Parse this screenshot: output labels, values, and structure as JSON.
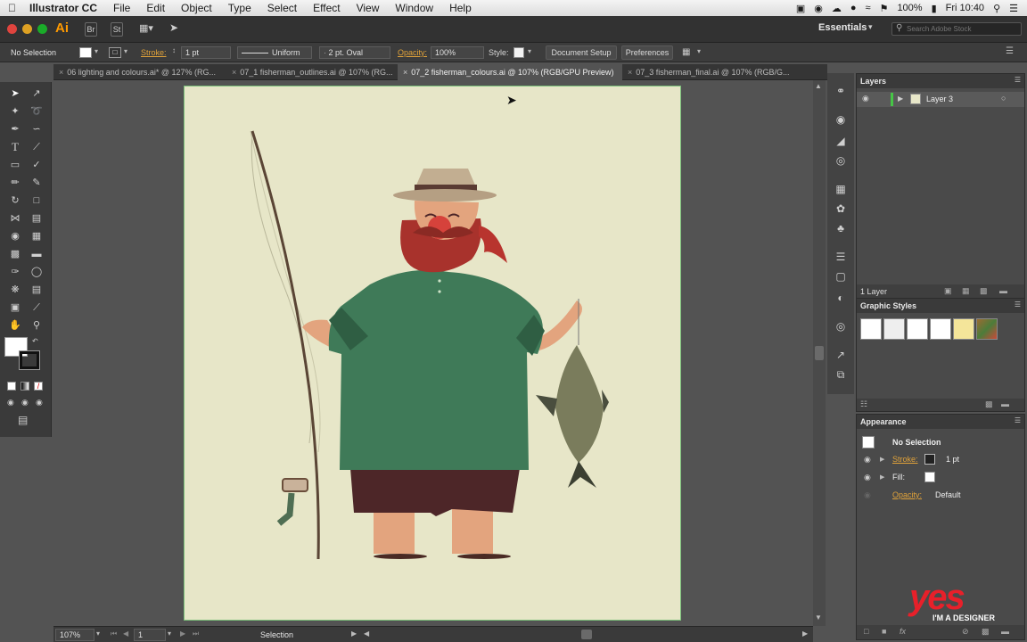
{
  "menubar": {
    "app_name": "Illustrator CC",
    "items": [
      "File",
      "Edit",
      "Object",
      "Type",
      "Select",
      "Effect",
      "View",
      "Window",
      "Help"
    ],
    "battery": "100%",
    "clock": "Fri 10:40"
  },
  "appbar": {
    "ai_logo": "Ai",
    "br_label": "Br",
    "st_label": "St",
    "workspace": "Essentials",
    "search_placeholder": "Search Adobe Stock"
  },
  "control": {
    "selection": "No Selection",
    "stroke_label": "Stroke:",
    "stroke_weight": "1 pt",
    "stroke_profile": "Uniform",
    "brush": "2 pt. Oval",
    "opacity_label": "Opacity:",
    "opacity": "100%",
    "style_label": "Style:",
    "document_setup": "Document Setup",
    "preferences": "Preferences"
  },
  "tabs": [
    {
      "label": "06 lighting and colours.ai* @ 127% (RG...",
      "active": false
    },
    {
      "label": "07_1 fisherman_outlines.ai @ 107% (RG...",
      "active": false
    },
    {
      "label": "07_2 fisherman_colours.ai @ 107% (RGB/GPU Preview)",
      "active": true
    },
    {
      "label": "07_3 fisherman_final.ai @ 107% (RGB/G...",
      "active": false
    }
  ],
  "layers": {
    "title": "Layers",
    "items": [
      {
        "name": "Layer 3"
      }
    ],
    "count": "1 Layer"
  },
  "graphic_styles": {
    "title": "Graphic Styles"
  },
  "appearance": {
    "title": "Appearance",
    "header": "No Selection",
    "rows": [
      {
        "label": "Stroke:",
        "value": "1 pt"
      },
      {
        "label": "Fill:",
        "value": ""
      },
      {
        "label": "Opacity:",
        "value": "Default"
      }
    ]
  },
  "status": {
    "zoom": "107%",
    "artboard": "1",
    "tool": "Selection"
  },
  "logo": {
    "big": "yes",
    "small": "I'M A DESIGNER"
  },
  "colors": {
    "artboard": "#e7e6c8",
    "shirt": "#3f7a58",
    "beard": "#a8322c",
    "accent_orange": "#e0a000"
  }
}
